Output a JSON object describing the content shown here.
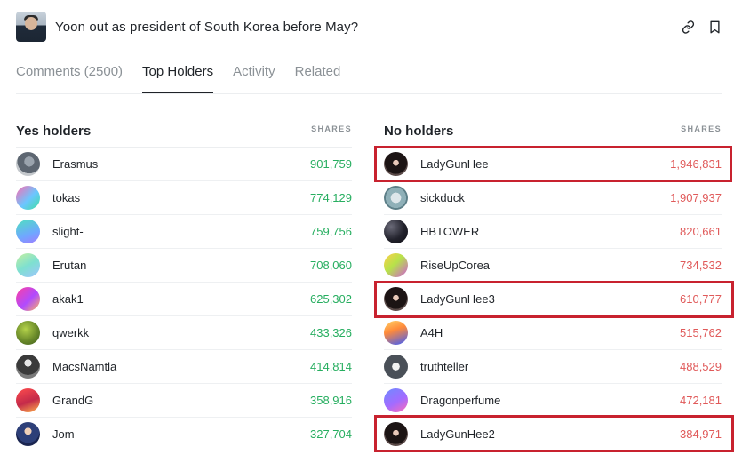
{
  "market": {
    "title": "Yoon out as president of South Korea before May?"
  },
  "tabs": [
    {
      "label": "Comments (2500)",
      "active": false
    },
    {
      "label": "Top Holders",
      "active": true
    },
    {
      "label": "Activity",
      "active": false
    },
    {
      "label": "Related",
      "active": false
    }
  ],
  "yes": {
    "title": "Yes holders",
    "shares_label": "SHARES",
    "color": "#27ae60",
    "holders": [
      {
        "name": "Erasmus",
        "shares": "901,759"
      },
      {
        "name": "tokas",
        "shares": "774,129"
      },
      {
        "name": "slight-",
        "shares": "759,756"
      },
      {
        "name": "Erutan",
        "shares": "708,060"
      },
      {
        "name": "akak1",
        "shares": "625,302"
      },
      {
        "name": "qwerkk",
        "shares": "433,326"
      },
      {
        "name": "MacsNamtla",
        "shares": "414,814"
      },
      {
        "name": "GrandG",
        "shares": "358,916"
      },
      {
        "name": "Jom",
        "shares": "327,704"
      }
    ]
  },
  "no": {
    "title": "No holders",
    "shares_label": "SHARES",
    "color": "#e05a5a",
    "holders": [
      {
        "name": "LadyGunHee",
        "shares": "1,946,831",
        "highlighted": true
      },
      {
        "name": "sickduck",
        "shares": "1,907,937",
        "highlighted": false
      },
      {
        "name": "HBTOWER",
        "shares": "820,661",
        "highlighted": false
      },
      {
        "name": "RiseUpCorea",
        "shares": "734,532",
        "highlighted": false
      },
      {
        "name": "LadyGunHee3",
        "shares": "610,777",
        "highlighted": true
      },
      {
        "name": "A4H",
        "shares": "515,762",
        "highlighted": false
      },
      {
        "name": "truthteller",
        "shares": "488,529",
        "highlighted": false
      },
      {
        "name": "Dragonperfume",
        "shares": "472,181",
        "highlighted": false
      },
      {
        "name": "LadyGunHee2",
        "shares": "384,971",
        "highlighted": true
      }
    ]
  },
  "annotation_color": "#c8222f",
  "icons": {
    "link": "link-icon",
    "bookmark": "bookmark-icon"
  }
}
